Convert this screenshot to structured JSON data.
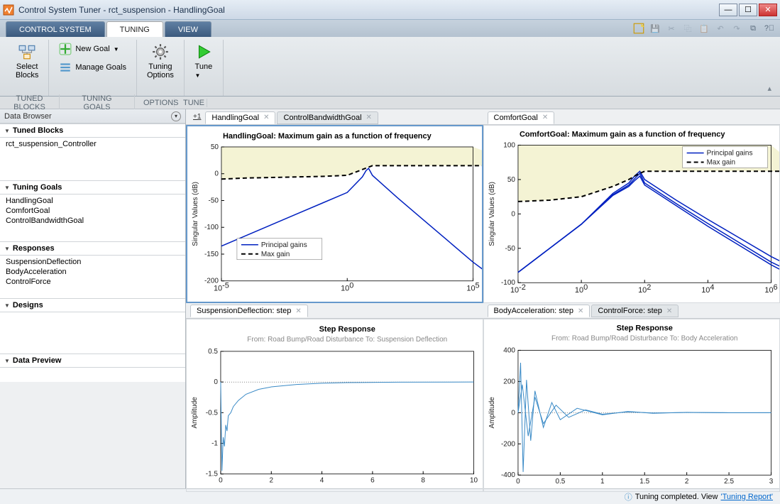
{
  "title": "Control System Tuner - rct_suspension - HandlingGoal",
  "tabs": {
    "control_system": "CONTROL SYSTEM",
    "tuning": "TUNING",
    "view": "VIEW"
  },
  "ribbon": {
    "select_blocks": "Select\nBlocks",
    "new_goal": "New Goal",
    "manage_goals": "Manage Goals",
    "tuning_options": "Tuning\nOptions",
    "tune": "Tune"
  },
  "sections": {
    "tuned_blocks": "TUNED BLOCKS",
    "tuning_goals": "TUNING GOALS",
    "options": "OPTIONS",
    "tune": "TUNE"
  },
  "sidebar": {
    "title": "Data Browser",
    "panels": [
      {
        "title": "Tuned Blocks",
        "items": [
          "rct_suspension_Controller"
        ]
      },
      {
        "title": "Tuning Goals",
        "items": [
          "HandlingGoal",
          "ComfortGoal",
          "ControlBandwidthGoal"
        ]
      },
      {
        "title": "Responses",
        "items": [
          "SuspensionDeflection",
          "BodyAcceleration",
          "ControlForce"
        ]
      },
      {
        "title": "Designs",
        "items": []
      },
      {
        "title": "Data Preview",
        "items": []
      }
    ]
  },
  "chart_tabs": {
    "top_left_plus": "+1",
    "top_left": [
      {
        "label": "HandlingGoal",
        "active": true
      },
      {
        "label": "ControlBandwidthGoal",
        "active": false
      }
    ],
    "top_right": [
      {
        "label": "ComfortGoal",
        "active": true
      }
    ],
    "bot_left": [
      {
        "label": "SuspensionDeflection: step",
        "active": true
      }
    ],
    "bot_right": [
      {
        "label": "BodyAcceleration: step",
        "active": true
      },
      {
        "label": "ControlForce: step",
        "active": false
      }
    ]
  },
  "status": {
    "text": "Tuning completed. View ",
    "link": "'Tuning Report'"
  },
  "chart_data": [
    {
      "id": "handling",
      "type": "line",
      "title": "HandlingGoal: Maximum gain as a function of frequency",
      "ylabel": "Singular Values (dB)",
      "xticks_log10": [
        -5,
        0,
        5
      ],
      "xtick_labels": [
        "10^-5",
        "10^0",
        "10^5"
      ],
      "ylim": [
        -200,
        50
      ],
      "yticks": [
        -200,
        -150,
        -100,
        -50,
        0,
        50
      ],
      "legend": [
        "Principal gains",
        "Max gain"
      ],
      "series": [
        {
          "name": "Principal gains",
          "style": "blue",
          "x_log10": [
            -5,
            -4,
            -3,
            -2,
            -1,
            0,
            0.6,
            0.75,
            0.85,
            1,
            2,
            3,
            4,
            5,
            6,
            7
          ],
          "y": [
            -135,
            -115,
            -95,
            -75,
            -55,
            -35,
            -6,
            6,
            10,
            -3,
            -45,
            -85,
            -125,
            -165,
            -200,
            -200
          ]
        },
        {
          "name": "Max gain",
          "style": "dash",
          "x_log10": [
            -5,
            -4,
            -3,
            -2,
            -1,
            0,
            0.5,
            1,
            2,
            3,
            4,
            5,
            6,
            7
          ],
          "y": [
            -10,
            -8,
            -7,
            -6,
            -5,
            -3,
            6,
            15,
            15,
            15,
            15,
            15,
            15,
            15
          ]
        }
      ]
    },
    {
      "id": "comfort",
      "type": "line",
      "title": "ComfortGoal: Maximum gain as a function of frequency",
      "ylabel": "Singular Values (dB)",
      "xticks_log10": [
        -2,
        0,
        2,
        4,
        6
      ],
      "xtick_labels": [
        "10^-2",
        "10^0",
        "10^2",
        "10^4",
        "10^6"
      ],
      "ylim": [
        -100,
        100
      ],
      "yticks": [
        -100,
        -50,
        0,
        50,
        100
      ],
      "legend": [
        "Principal gains",
        "Max gain"
      ],
      "series": [
        {
          "name": "Principal gains 1",
          "style": "blue",
          "x_log10": [
            -2,
            -1,
            0,
            1,
            1.5,
            1.7,
            1.85,
            2,
            3,
            4,
            5,
            6,
            7
          ],
          "y": [
            -85,
            -50,
            -15,
            30,
            45,
            56,
            62,
            50,
            20,
            -8,
            -35,
            -62,
            -85
          ]
        },
        {
          "name": "Principal gains 2",
          "style": "blue",
          "x_log10": [
            -2,
            -1,
            0,
            1,
            1.5,
            1.7,
            1.85,
            2,
            3,
            4,
            5,
            6,
            7
          ],
          "y": [
            -85,
            -50,
            -15,
            28,
            42,
            52,
            59,
            45,
            15,
            -14,
            -42,
            -70,
            -92
          ]
        },
        {
          "name": "Principal gains 3",
          "style": "blue",
          "x_log10": [
            -2,
            -1,
            0,
            1,
            1.5,
            1.7,
            1.85,
            2,
            3,
            4,
            5,
            6,
            7
          ],
          "y": [
            -85,
            -50,
            -15,
            27,
            40,
            49,
            55,
            42,
            12,
            -18,
            -46,
            -74,
            -98
          ]
        },
        {
          "name": "Max gain",
          "style": "dash",
          "x_log10": [
            -2,
            -1,
            0,
            1,
            1.5,
            1.8,
            2,
            3,
            4,
            5,
            6,
            7
          ],
          "y": [
            18,
            20,
            25,
            40,
            50,
            58,
            62,
            62,
            62,
            62,
            62,
            62
          ]
        }
      ]
    },
    {
      "id": "suspension_step",
      "type": "line",
      "title": "Step Response",
      "subtitle_from": "From: Road Bump/Road Disturbance",
      "subtitle_to": "To: Suspension Deflection",
      "ylabel": "Amplitude",
      "xlim": [
        0,
        10
      ],
      "xticks": [
        0,
        2,
        4,
        6,
        8,
        10
      ],
      "ylim": [
        -1.5,
        0.5
      ],
      "yticks": [
        -1.5,
        -1,
        -0.5,
        0,
        0.5
      ],
      "series": [
        {
          "name": "response",
          "style": "lightblue",
          "x": [
            0,
            0.05,
            0.1,
            0.15,
            0.2,
            0.25,
            0.3,
            0.4,
            0.5,
            0.7,
            1,
            1.5,
            2,
            3,
            4,
            5,
            7,
            10
          ],
          "y": [
            0,
            -1.45,
            -0.9,
            -1.05,
            -0.7,
            -0.8,
            -0.55,
            -0.5,
            -0.4,
            -0.3,
            -0.2,
            -0.12,
            -0.08,
            -0.04,
            -0.02,
            -0.01,
            -0.003,
            0
          ]
        }
      ]
    },
    {
      "id": "body_accel_step",
      "type": "line",
      "title": "Step Response",
      "subtitle_from": "From: Road Bump/Road Disturbance",
      "subtitle_to": "To: Body Acceleration",
      "ylabel": "Amplitude",
      "xlim": [
        0,
        3
      ],
      "xticks": [
        0,
        0.5,
        1,
        1.5,
        2,
        2.5,
        3
      ],
      "ylim": [
        -400,
        400
      ],
      "yticks": [
        -400,
        -200,
        0,
        200,
        400
      ],
      "series": [
        {
          "name": "response1",
          "style": "lightblue",
          "x": [
            0,
            0.03,
            0.06,
            0.1,
            0.15,
            0.2,
            0.3,
            0.4,
            0.5,
            0.7,
            1,
            1.3,
            1.6,
            2,
            2.5,
            3
          ],
          "y": [
            0,
            320,
            -380,
            210,
            -180,
            140,
            -95,
            65,
            -45,
            28,
            -14,
            8,
            -4,
            2,
            -1,
            0
          ]
        },
        {
          "name": "response2",
          "style": "lightblue",
          "x": [
            0,
            0.05,
            0.12,
            0.2,
            0.3,
            0.45,
            0.6,
            0.8,
            1,
            1.3,
            1.6,
            2,
            2.5,
            3
          ],
          "y": [
            0,
            180,
            -150,
            100,
            -70,
            48,
            -30,
            18,
            -10,
            5,
            -2,
            1,
            0,
            0
          ]
        }
      ]
    }
  ]
}
